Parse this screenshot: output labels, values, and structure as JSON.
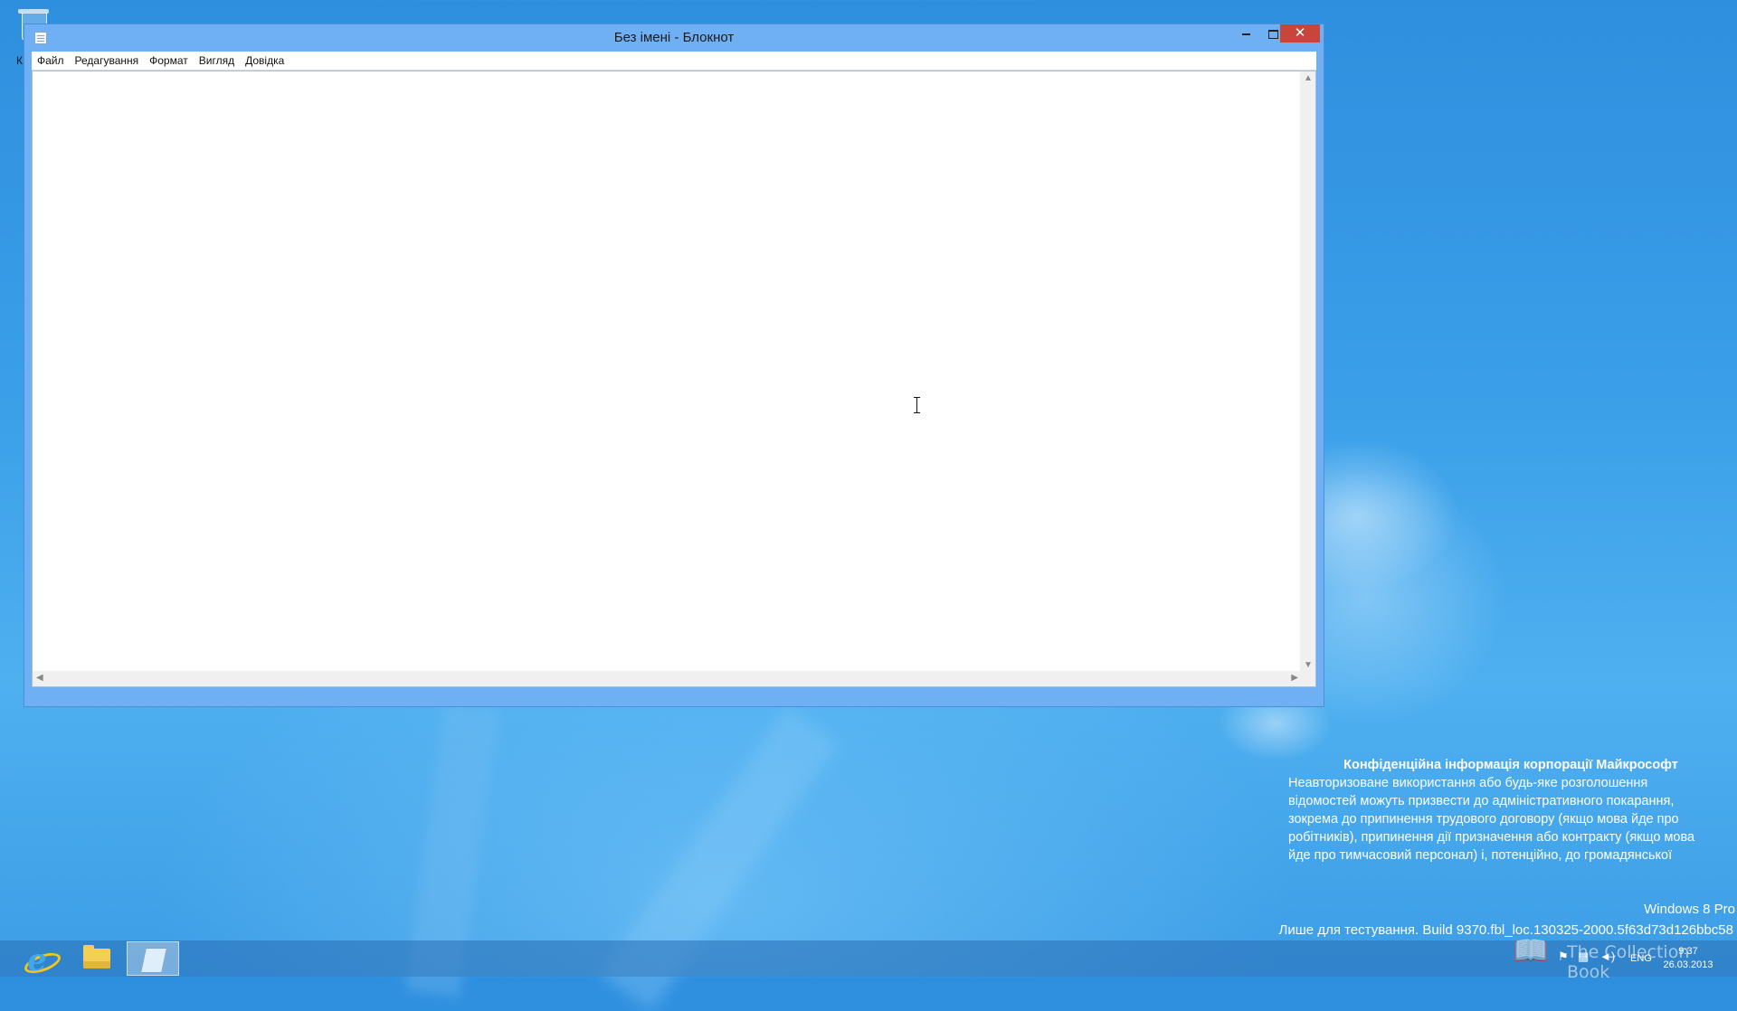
{
  "desktop": {
    "recycle_label": "К"
  },
  "window": {
    "title": "Без імені - Блокнот",
    "controls": {
      "minimize": "–",
      "maximize": "□",
      "close": "✕"
    },
    "menu": [
      "Файл",
      "Редагування",
      "Формат",
      "Вигляд",
      "Довідка"
    ],
    "editor_text": ""
  },
  "watermark": {
    "title": "Конфіденційна інформація корпорації Майкрософт",
    "lines": [
      "Неавторизоване використання або будь-яке розголошення",
      "відомостей можуть призвести до адміністративного покарання,",
      "зокрема до припинення трудового договору (якщо мова йде про",
      "робітників), припинення дії призначення або контракту (якщо мова",
      "йде про тимчасовий персонал) і, потенційно, до громадянської"
    ],
    "edition": "Windows 8 Pro",
    "build": "Лише для тестування. Build 9370.fbl_loc.130325-2000.5f63d73d126bbc58"
  },
  "taskbar": {
    "pinned": [
      "internet-explorer-icon",
      "file-explorer-icon",
      "notepad-icon"
    ],
    "language": "ENG",
    "time": "9:37",
    "date": "26.03.2013",
    "overlay_text": "The Collection Book"
  }
}
